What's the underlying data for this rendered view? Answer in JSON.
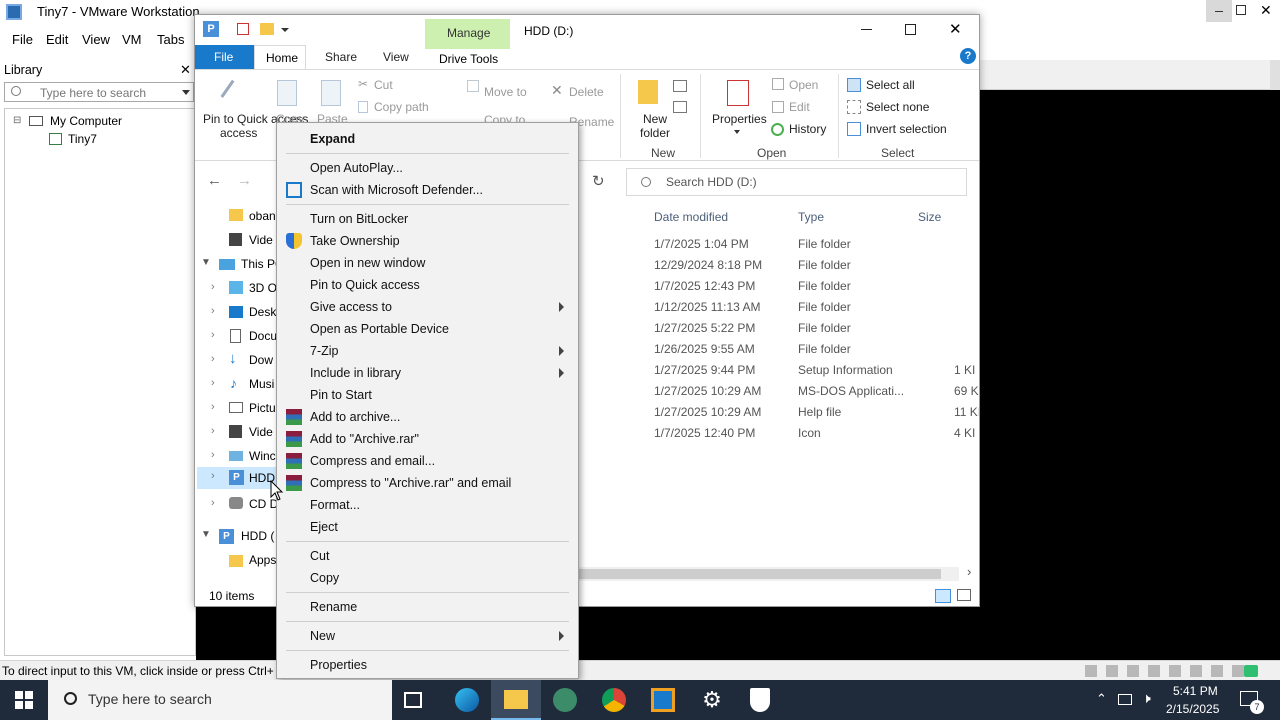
{
  "vmware": {
    "title": "Tiny7 - VMware Workstation",
    "menu": [
      "File",
      "Edit",
      "View",
      "VM",
      "Tabs"
    ],
    "library_label": "Library",
    "library_search_placeholder": "Type here to search",
    "tree": [
      "My Computer",
      "Tiny7"
    ],
    "status_text": "To direct input to this VM, click inside or press Ctrl+"
  },
  "explorer": {
    "title": "HDD (D:)",
    "contextual_tab": "Manage",
    "tabs": [
      "File",
      "Home",
      "Share",
      "View",
      "Drive Tools"
    ],
    "ribbon": {
      "pin_quick_access": "Pin to Quick access",
      "copy": "Copy",
      "paste": "Paste",
      "cut": "Cut",
      "copy_path": "Copy path",
      "move_to": "Move to",
      "copy_to": "Copy to",
      "delete": "Delete",
      "rename": "Rename",
      "new_folder": "New folder",
      "new_group": "New",
      "properties": "Properties",
      "open": "Open",
      "edit": "Edit",
      "history": "History",
      "open_group": "Open",
      "select_all": "Select all",
      "select_none": "Select none",
      "invert_selection": "Invert selection",
      "select_group": "Select"
    },
    "search_placeholder": "Search HDD (D:)",
    "columns": [
      "Date modified",
      "Type",
      "Size"
    ],
    "rows": [
      {
        "date": "1/7/2025 1:04 PM",
        "type": "File folder",
        "size": ""
      },
      {
        "date": "12/29/2024 8:18 PM",
        "type": "File folder",
        "size": ""
      },
      {
        "date": "1/7/2025 12:43 PM",
        "type": "File folder",
        "size": ""
      },
      {
        "date": "1/12/2025 11:13 AM",
        "type": "File folder",
        "size": ""
      },
      {
        "date": "1/27/2025 5:22 PM",
        "type": "File folder",
        "size": ""
      },
      {
        "date": "1/26/2025 9:55 AM",
        "type": "File folder",
        "size": ""
      },
      {
        "date": "1/27/2025 9:44 PM",
        "type": "Setup Information",
        "size": "1 KI"
      },
      {
        "date": "1/27/2025 10:29 AM",
        "type": "MS-DOS Applicati...",
        "size": "69 KI"
      },
      {
        "date": "1/27/2025 10:29 AM",
        "type": "Help file",
        "size": "11 KI"
      },
      {
        "date": "1/7/2025 12:40 PM",
        "type": "Icon",
        "size": "4 KI"
      }
    ],
    "nav": [
      "oban",
      "Vide",
      "This PC",
      "3D O",
      "Desk",
      "Docu",
      "Dow",
      "Musi",
      "Pictu",
      "Vide",
      "Winc",
      "HDD",
      "CD D",
      "HDD (",
      "Apps"
    ],
    "item_count": "10 items"
  },
  "context_menu": {
    "items": [
      "Expand",
      "Open AutoPlay...",
      "Scan with Microsoft Defender...",
      "Turn on BitLocker",
      "Take Ownership",
      "Open in new window",
      "Pin to Quick access",
      "Give access to",
      "Open as Portable Device",
      "7-Zip",
      "Include in library",
      "Pin to Start",
      "Add to archive...",
      "Add to \"Archive.rar\"",
      "Compress and email...",
      "Compress to \"Archive.rar\" and email",
      "Format...",
      "Eject",
      "Cut",
      "Copy",
      "Rename",
      "New",
      "Properties"
    ]
  },
  "taskbar": {
    "search_placeholder": "Type here to search",
    "time": "5:41 PM",
    "date": "2/15/2025",
    "notification_count": "7"
  },
  "colors": {
    "accent": "#1979ca",
    "manage_tab": "#cdf0b0",
    "taskbar": "#1f2b3a"
  }
}
